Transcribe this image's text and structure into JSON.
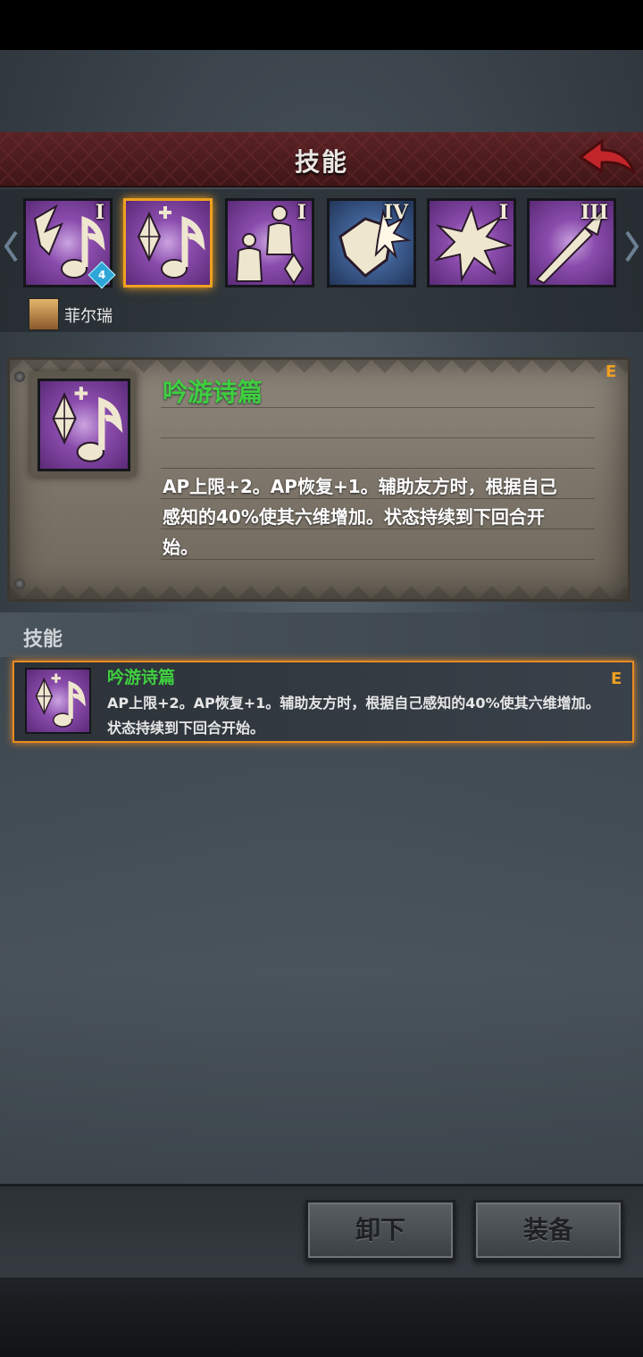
{
  "header": {
    "title": "技能"
  },
  "skills": [
    {
      "roman": "I",
      "badge": "4",
      "selected": false,
      "theme": "purple"
    },
    {
      "roman": "",
      "badge": "",
      "selected": true,
      "theme": "purple"
    },
    {
      "roman": "I",
      "badge": "",
      "selected": false,
      "theme": "purple"
    },
    {
      "roman": "IV",
      "badge": "",
      "selected": false,
      "theme": "blue"
    },
    {
      "roman": "I",
      "badge": "",
      "selected": false,
      "theme": "purple"
    },
    {
      "roman": "III",
      "badge": "",
      "selected": false,
      "theme": "purple"
    }
  ],
  "character": {
    "name": "菲尔瑞"
  },
  "detail": {
    "title": "吟游诗篇",
    "grade": "E",
    "description": "AP上限+2。AP恢复+1。辅助友方时，根据自己感知的40%使其六维增加。状态持续到下回合开始。"
  },
  "section": {
    "label": "技能"
  },
  "list": [
    {
      "title": "吟游诗篇",
      "grade": "E",
      "description": "AP上限+2。AP恢复+1。辅助友方时，根据自己感知的40%使其六维增加。状态持续到下回合开始。"
    }
  ],
  "buttons": {
    "unequip": "卸下",
    "equip": "装备"
  },
  "colors": {
    "accent_orange": "#f0a020",
    "title_green": "#3fcf3f",
    "header_red": "#5a2225"
  }
}
